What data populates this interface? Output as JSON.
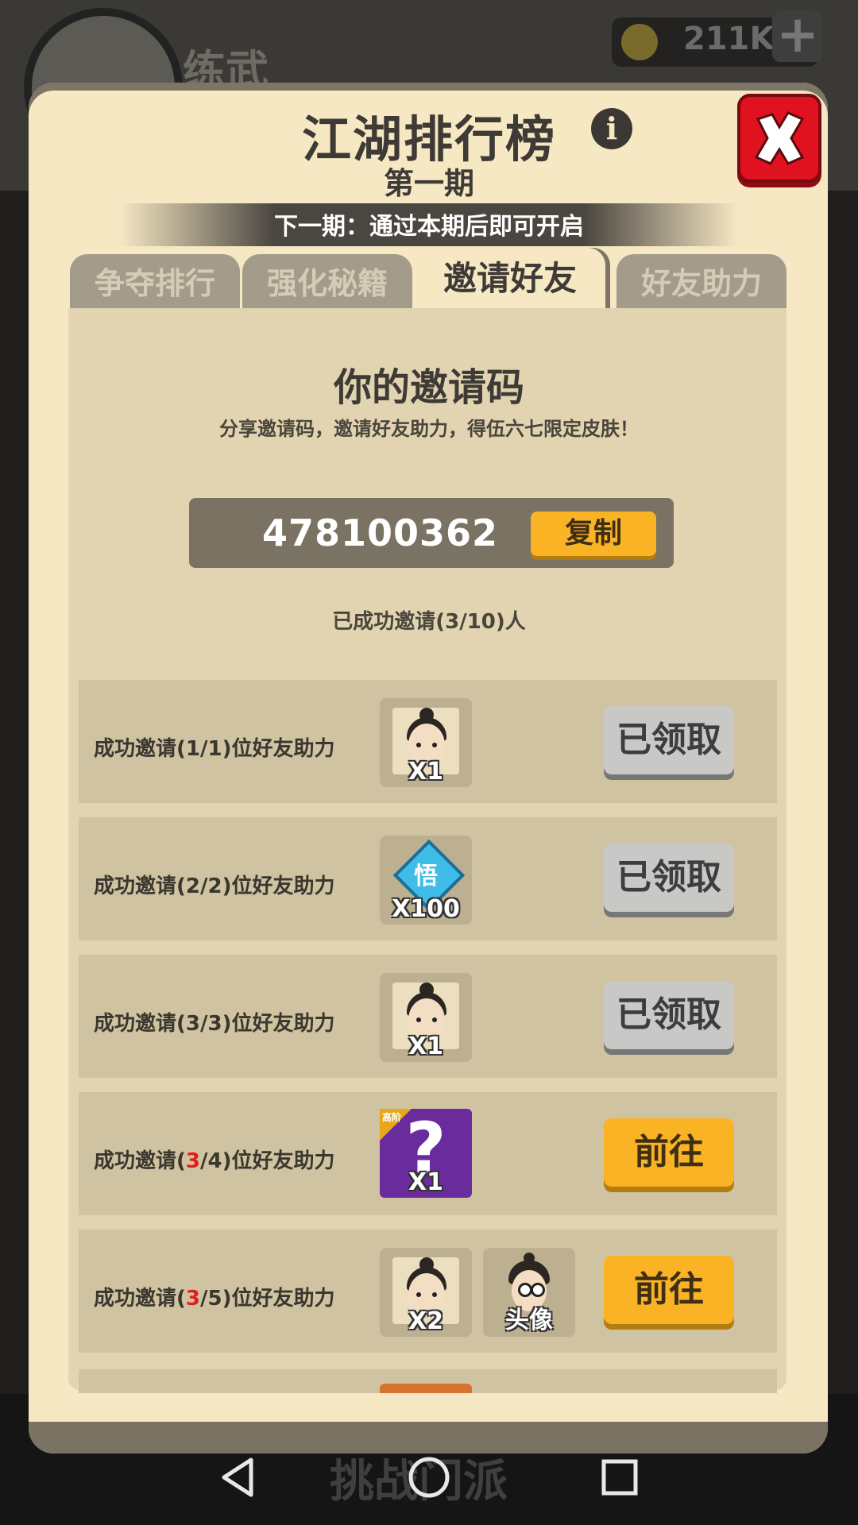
{
  "background": {
    "screen_title": "练武",
    "coins": "211K",
    "bottom_label": "挑战门派"
  },
  "header": {
    "title": "江湖排行榜",
    "period": "第一期",
    "next_period": "下一期：通过本期后即可开启"
  },
  "tabs": [
    {
      "label": "争夺排行",
      "active": false
    },
    {
      "label": "强化秘籍",
      "active": false
    },
    {
      "label": "邀请好友",
      "active": true
    },
    {
      "label": "好友助力",
      "active": false
    }
  ],
  "invite": {
    "heading": "你的邀请码",
    "description": "分享邀请码，邀请好友助力，得伍六七限定皮肤！",
    "code": "478100362",
    "copy_label": "复制",
    "invited_status": "已成功邀请(3/10)人"
  },
  "rewards": [
    {
      "prefix": "成功邀请(",
      "current": "1",
      "slash": "/1)位好友助力",
      "items": [
        {
          "icon": "character-portrait-icon",
          "qty": "X1"
        }
      ],
      "button": "已领取",
      "state": "claimed"
    },
    {
      "prefix": "成功邀请(",
      "current": "2",
      "slash": "/2)位好友助力",
      "items": [
        {
          "icon": "insight-diamond-icon",
          "symbol": "悟",
          "qty": "X100"
        }
      ],
      "button": "已领取",
      "state": "claimed"
    },
    {
      "prefix": "成功邀请(",
      "current": "3",
      "slash": "/3)位好友助力",
      "items": [
        {
          "icon": "character-portrait-icon",
          "qty": "X1"
        }
      ],
      "button": "已领取",
      "state": "claimed"
    },
    {
      "prefix": "成功邀请(",
      "current": "3",
      "slash": "/4)位好友助力",
      "items": [
        {
          "icon": "mystery-box-icon",
          "tag": "高阶",
          "qty": "X1"
        }
      ],
      "button": "前往",
      "state": "go"
    },
    {
      "prefix": "成功邀请(",
      "current": "3",
      "slash": "/5)位好友助力",
      "items": [
        {
          "icon": "character-portrait-icon",
          "qty": "X2"
        },
        {
          "icon": "avatar-frame-icon",
          "qty": "头像"
        }
      ],
      "button": "前往",
      "state": "go"
    }
  ],
  "colors": {
    "panel": "#f7e8c4",
    "accent_button": "#f9b324",
    "claimed_button": "#c8c8c6",
    "close_button": "#e0121f",
    "highlight_red": "#e01e1e"
  }
}
